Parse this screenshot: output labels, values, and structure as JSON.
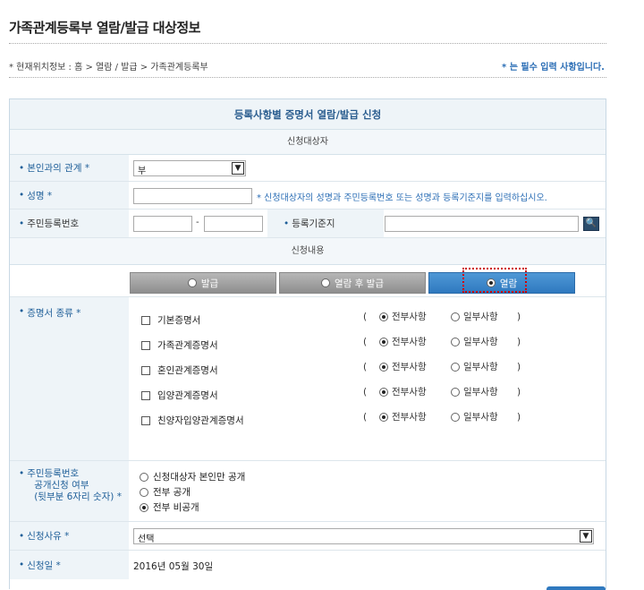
{
  "page_title": "가족관계등록부 열람/발급 대상정보",
  "location": "* 현재위치정보 : 홈 > 열람 / 발급 > 가족관계등록부",
  "required_note": "* 는 필수 입력 사항입니다.",
  "form_title": "등록사항별 증명서 열람/발급 신청",
  "section_applicant": "신청대상자",
  "section_content": "신청내용",
  "relation": {
    "label": "본인과의 관계 *",
    "value": "부"
  },
  "name": {
    "label": "성명 *",
    "value": "",
    "hint": "* 신청대상자의 성명과 주민등록번호 또는 성명과 등록기준지를 입력하십시오."
  },
  "rrn": {
    "label": "주민등록번호",
    "dash": "-"
  },
  "registry_base": {
    "label": "등록기준지"
  },
  "tabs": [
    {
      "label": "발급",
      "selected": false
    },
    {
      "label": "열람 후 발급",
      "selected": false
    },
    {
      "label": "열람",
      "selected": true
    }
  ],
  "cert_type": {
    "label": "증명서 종류 *",
    "items": [
      "기본증명서",
      "가족관계증명서",
      "혼인관계증명서",
      "입양관계증명서",
      "친양자입양관계증명서"
    ],
    "open_paren": "(",
    "close_paren": ")",
    "option_full": "전부사항",
    "option_partial": "일부사항"
  },
  "rrn_disclosure": {
    "label1": "주민등록번호",
    "label2": "공개신청 여부",
    "label3": "(뒷부분 6자리 숫자) *",
    "options": [
      {
        "label": "신청대상자 본인만 공개",
        "selected": false
      },
      {
        "label": "전부 공개",
        "selected": false
      },
      {
        "label": "전부 비공개",
        "selected": true
      }
    ]
  },
  "reason": {
    "label": "신청사유 *",
    "value": "선택"
  },
  "date": {
    "label": "신청일 *",
    "value": "2016년 05월 30일"
  },
  "colors": {
    "accent": "#2f79bf",
    "label_text": "#1f5f99",
    "highlight_border": "#cc0000"
  }
}
